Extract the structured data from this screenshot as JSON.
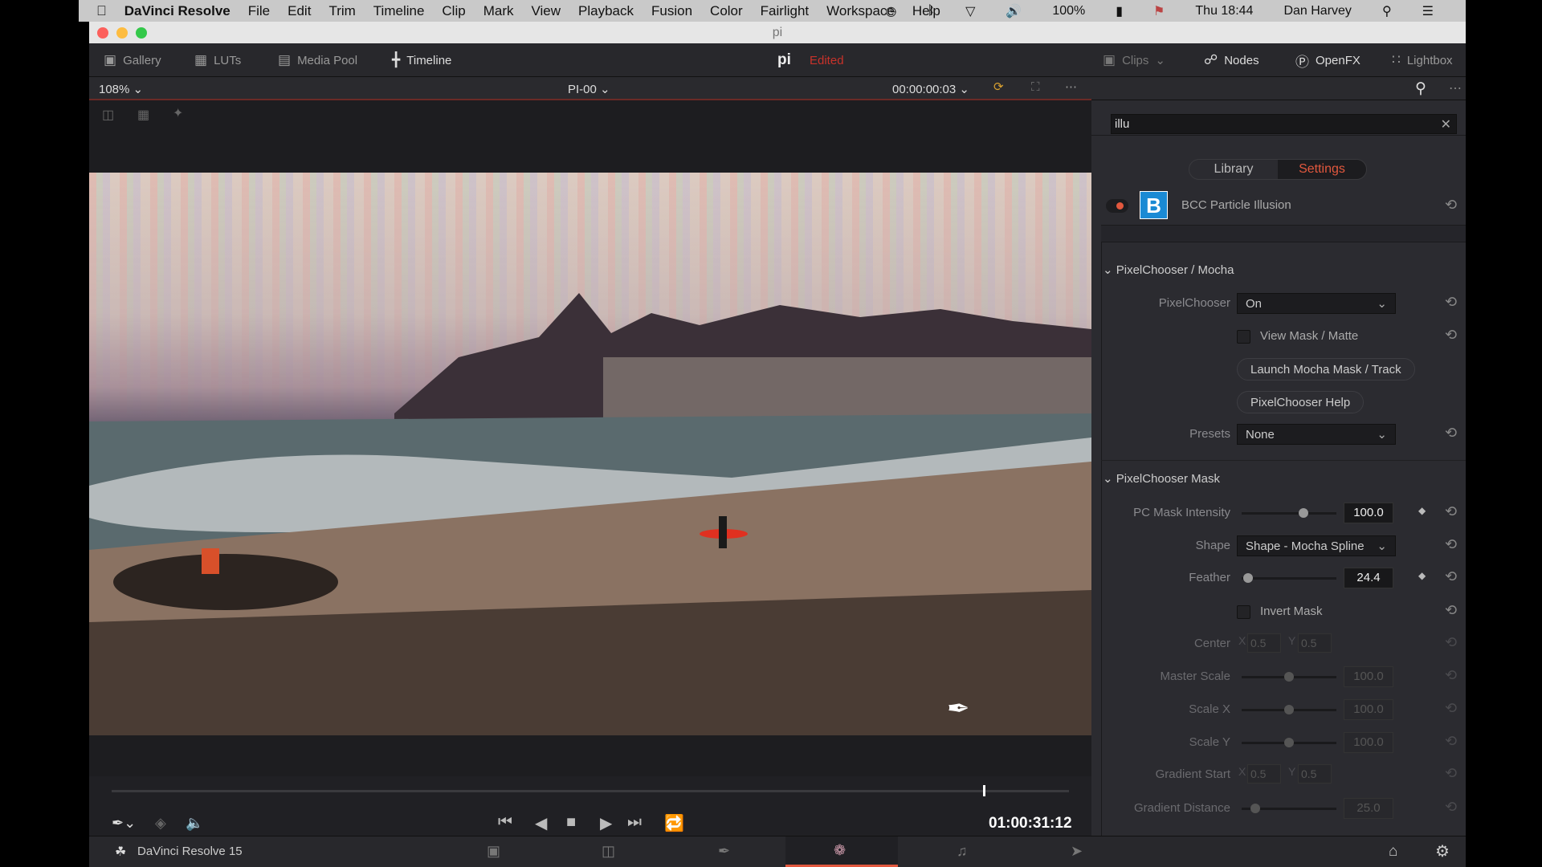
{
  "menubar": {
    "app": "DaVinci Resolve",
    "items": [
      "File",
      "Edit",
      "Trim",
      "Timeline",
      "Clip",
      "Mark",
      "View",
      "Playback",
      "Fusion",
      "Color",
      "Fairlight",
      "Workspace",
      "Help"
    ],
    "battery": "100%",
    "clock": "Thu 18:44",
    "user": "Dan Harvey"
  },
  "window": {
    "title": "pi"
  },
  "toolbar": {
    "left": [
      "Gallery",
      "LUTs",
      "Media Pool",
      "Timeline"
    ],
    "project": "pi",
    "status": "Edited",
    "right": [
      "Clips",
      "Nodes",
      "OpenFX",
      "Lightbox"
    ]
  },
  "viewer": {
    "zoom": "108%",
    "clip": "PI-00",
    "timecode": "00:00:00:03",
    "playhead_timecode": "01:00:31:12",
    "scrub_position": 0.91
  },
  "openfx": {
    "search": "illu",
    "tabs": [
      "Library",
      "Settings"
    ],
    "active_tab": "Settings",
    "plugin": "BCC Particle Illusion",
    "plugin_logo": "B",
    "section1": "PixelChooser / Mocha",
    "pixelchooser_label": "PixelChooser",
    "pixelchooser_value": "On",
    "view_mask": "View Mask / Matte",
    "launch_mocha": "Launch Mocha Mask / Track",
    "pc_help": "PixelChooser Help",
    "presets_label": "Presets",
    "presets_value": "None",
    "section2": "PixelChooser Mask",
    "pc_mask_intensity_label": "PC Mask Intensity",
    "pc_mask_intensity": "100.0",
    "pc_mask_intensity_pos": 0.65,
    "shape_label": "Shape",
    "shape_value": "Shape - Mocha Spline",
    "feather_label": "Feather",
    "feather": "24.4",
    "feather_pos": 0.07,
    "invert_mask": "Invert Mask",
    "center_label": "Center",
    "center_x": "0.5",
    "center_y": "0.5",
    "x": "X",
    "y": "Y",
    "master_scale_label": "Master Scale",
    "master_scale": "100.0",
    "scale_x_label": "Scale X",
    "scale_x": "100.0",
    "scale_y_label": "Scale Y",
    "scale_y": "100.0",
    "gradient_start_label": "Gradient Start",
    "gradient_start_x": "0.5",
    "gradient_start_y": "0.5",
    "gradient_distance_label": "Gradient Distance",
    "gradient_distance": "25.0"
  },
  "footer": {
    "app_version": "DaVinci Resolve 15",
    "active_page": "color"
  },
  "colors": {
    "accent": "#e2583e",
    "edited": "#c8322a"
  }
}
